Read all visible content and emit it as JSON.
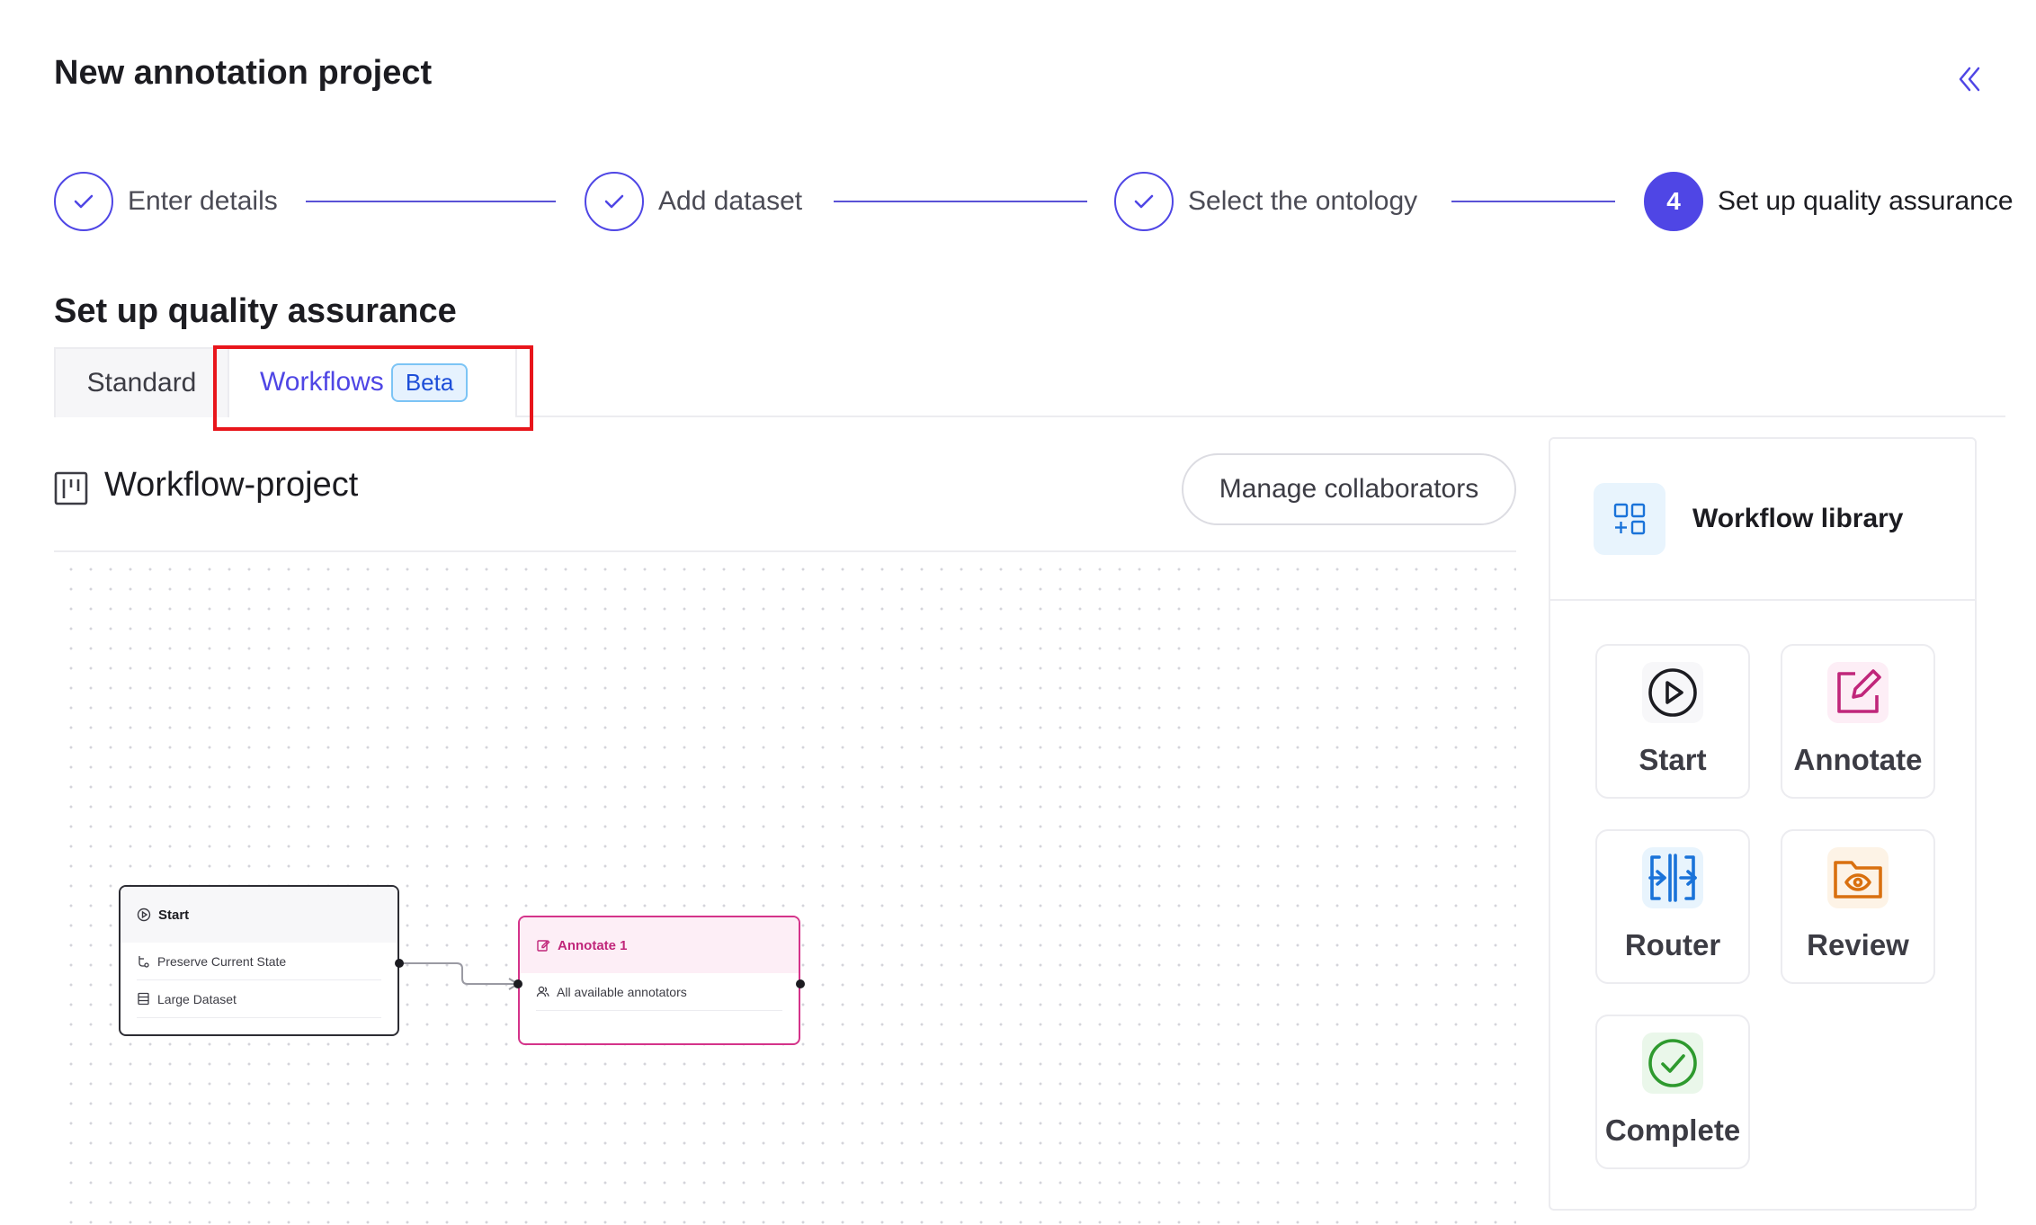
{
  "header": {
    "title": "New annotation project"
  },
  "stepper": {
    "steps": [
      {
        "label": "Enter details",
        "status": "done"
      },
      {
        "label": "Add dataset",
        "status": "done"
      },
      {
        "label": "Select the ontology",
        "status": "done"
      },
      {
        "label": "Set up quality assurance",
        "status": "active",
        "number": "4"
      }
    ]
  },
  "section": {
    "title": "Set up quality assurance"
  },
  "tabs": {
    "standard": "Standard",
    "workflows": "Workflows",
    "workflows_badge": "Beta",
    "selected": "Workflows"
  },
  "workflow": {
    "name": "Workflow-project",
    "manage_collaborators": "Manage collaborators",
    "nodes": {
      "start": {
        "title": "Start",
        "rows": [
          "Preserve Current State",
          "Large Dataset"
        ]
      },
      "annotate": {
        "title": "Annotate 1",
        "rows": [
          "All available annotators"
        ]
      }
    }
  },
  "library": {
    "title": "Workflow library",
    "items": [
      {
        "label": "Start",
        "icon": "play-circle-icon",
        "color": "#1c1c21"
      },
      {
        "label": "Annotate",
        "icon": "edit-icon",
        "color": "#c0267a"
      },
      {
        "label": "Router",
        "icon": "router-icon",
        "color": "#1a73d9"
      },
      {
        "label": "Review",
        "icon": "review-folder-icon",
        "color": "#d9700f"
      },
      {
        "label": "Complete",
        "icon": "check-circle-icon",
        "color": "#2e9a2e"
      }
    ]
  },
  "colors": {
    "accent": "#4f46e5",
    "annotate": "#c0267a",
    "highlight": "#e8151b",
    "badge_bg": "#e6f2fe"
  }
}
